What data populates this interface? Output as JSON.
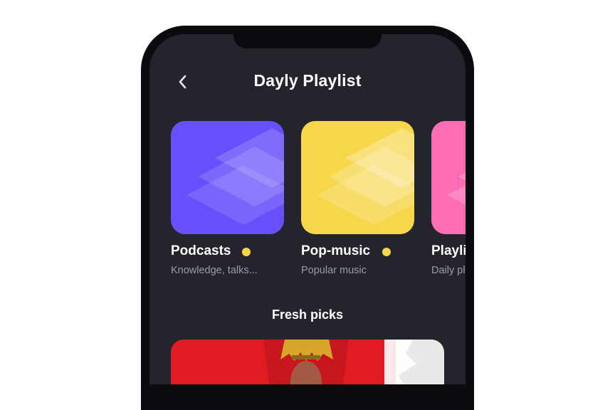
{
  "header": {
    "title": "Dayly Playlist",
    "back_icon": "chevron-left-icon"
  },
  "playlists": [
    {
      "name": "Podcasts",
      "subtitle": "Knowledge, talks...",
      "color": "#6650fb",
      "indicator_color": "#f7d64a"
    },
    {
      "name": "Pop-music",
      "subtitle": "Popular music",
      "color": "#f7d64a",
      "indicator_color": "#f7d64a"
    },
    {
      "name": "Playlist",
      "subtitle": "Daily playlist",
      "color": "#ff6eb5"
    }
  ],
  "fresh_picks": {
    "title": "Fresh picks"
  },
  "colors": {
    "screen_bg": "#24252c",
    "phone_frame": "#0b0b0f",
    "accent_dot": "#f7d64a"
  }
}
